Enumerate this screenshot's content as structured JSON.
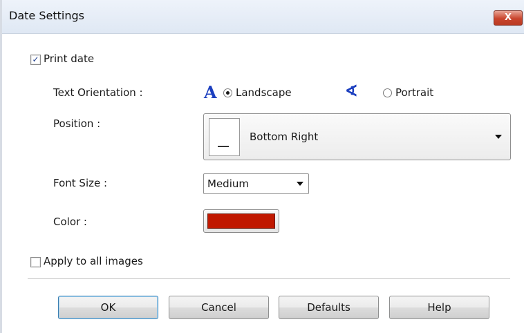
{
  "window": {
    "title": "Date Settings",
    "close_label": "X"
  },
  "print_date": {
    "label": "Print date",
    "checked": true
  },
  "text_orientation": {
    "label": "Text Orientation :",
    "options": [
      {
        "label": "Landscape",
        "selected": true,
        "icon": "landscape-text-icon"
      },
      {
        "label": "Portrait",
        "selected": false,
        "icon": "portrait-text-icon"
      }
    ]
  },
  "position": {
    "label": "Position :",
    "value": "Bottom Right"
  },
  "font_size": {
    "label": "Font Size :",
    "value": "Medium"
  },
  "color": {
    "label": "Color :",
    "value": "#c01800"
  },
  "apply_all": {
    "label": "Apply to all images",
    "checked": false
  },
  "buttons": {
    "ok": "OK",
    "cancel": "Cancel",
    "defaults": "Defaults",
    "help": "Help"
  }
}
